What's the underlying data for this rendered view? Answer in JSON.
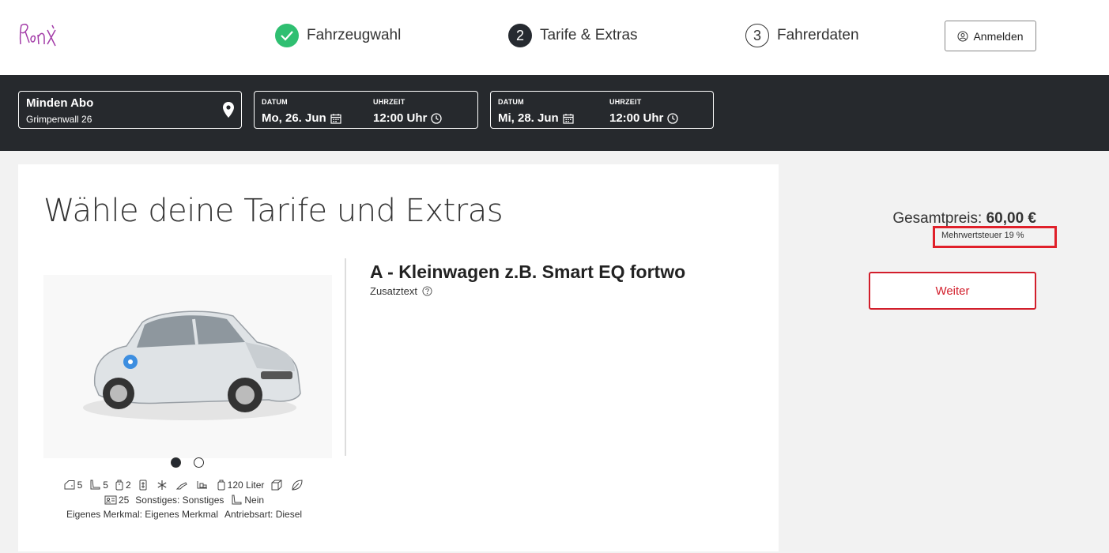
{
  "header": {
    "steps": [
      {
        "number": "✓",
        "label": "Fahrzeugwahl"
      },
      {
        "number": "2",
        "label": "Tarife & Extras"
      },
      {
        "number": "3",
        "label": "Fahrerdaten"
      }
    ],
    "login_label": "Anmelden"
  },
  "search": {
    "location_title": "Minden Abo",
    "location_address": "Grimpenwall 26",
    "pickup": {
      "date_label": "DATUM",
      "date": "Mo, 26. Jun",
      "time_label": "UHRZEIT",
      "time": "12:00 Uhr"
    },
    "return": {
      "date_label": "DATUM",
      "date": "Mi, 28. Jun",
      "time_label": "UHRZEIT",
      "time": "12:00 Uhr"
    }
  },
  "main": {
    "title": "Wähle deine Tarife und Extras",
    "car_title": "A - Kleinwagen z.B. Smart EQ fortwo",
    "car_subtext": "Zusatztext",
    "carousel_active_index": 0,
    "features": {
      "doors": "5",
      "seats": "5",
      "bags": "2",
      "tank": "120 Liter",
      "min_age": "25",
      "misc": "Sonstiges: Sonstiges",
      "child_seat": "Nein",
      "own_feature": "Eigenes Merkmal: Eigenes Merkmal",
      "drive": "Antriebsart: Diesel"
    }
  },
  "summary": {
    "total_label": "Gesamtpreis:",
    "total_value": "60,00 €",
    "vat_text": "Mehrwertsteuer 19 %",
    "next_label": "Weiter"
  },
  "colors": {
    "accent_red": "#d21e2b",
    "highlight_red": "#e0202a",
    "dark_bar": "#26292d",
    "step_done": "#2fbf71"
  }
}
